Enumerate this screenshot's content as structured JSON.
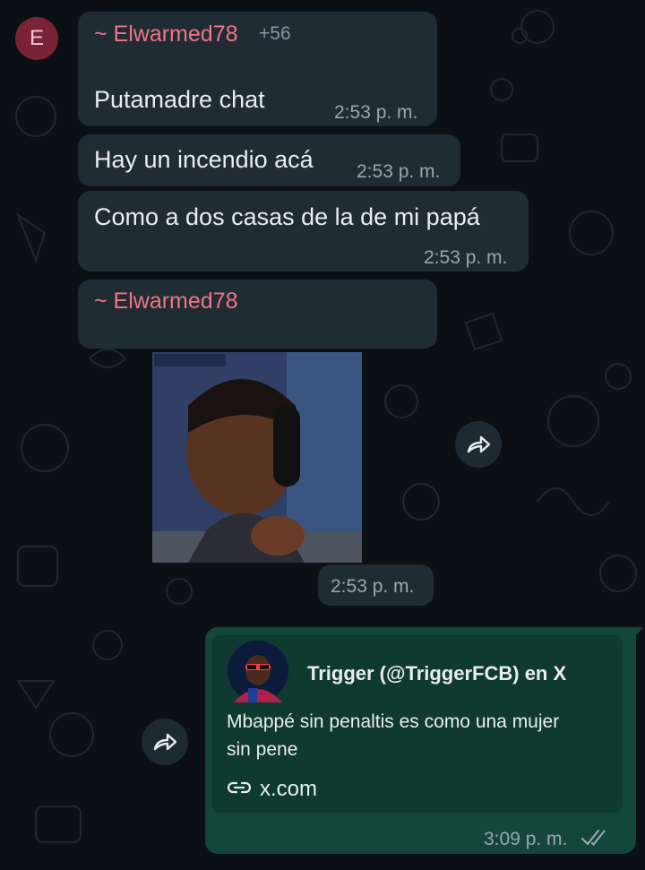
{
  "colors": {
    "background": "#0b1014",
    "incoming_bubble": "#1f2c34",
    "outgoing_bubble": "#13473a",
    "sender_name": "#f07583",
    "timestamp": "#9aa6ad",
    "read_ticks": "#9aa6ad"
  },
  "chat": {
    "avatar_letter": "E",
    "messages": [
      {
        "sender": "~ Elwarmed78",
        "sender_extra": "+56",
        "text": "Putamadre chat",
        "time": "2:53 p. m."
      },
      {
        "text": "Hay un incendio acá",
        "time": "2:53 p. m."
      },
      {
        "text": "Como a dos casas de la de mi papá",
        "time": "2:53 p. m."
      },
      {
        "sender": "~ Elwarmed78",
        "type": "sticker",
        "time": "2:53 p. m."
      },
      {
        "type": "link_preview",
        "preview_title": "Trigger (@TriggerFCB) en X",
        "preview_text": "Mbappé sin penaltis es como una mujer sin pene",
        "preview_link": "x.com",
        "time": "3:09 p. m."
      }
    ]
  },
  "icons": {
    "forward": "forward-icon",
    "link": "link-icon",
    "read_receipt": "double-check-icon"
  }
}
